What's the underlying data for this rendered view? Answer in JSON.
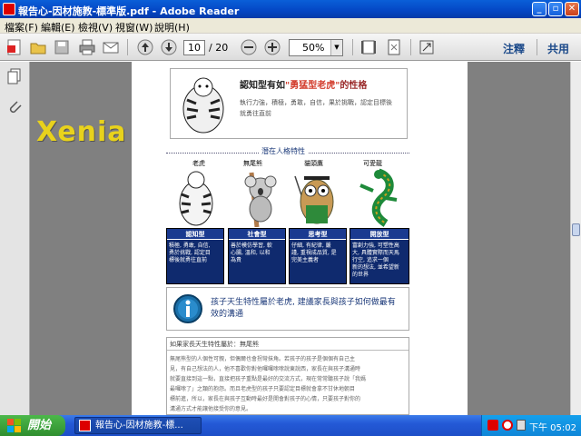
{
  "window": {
    "title": "報告心-因材施教-標準版.pdf - Adobe Reader"
  },
  "menu": [
    "檔案(F)",
    "編輯(E)",
    "檢視(V)",
    "視窗(W)",
    "說明(H)"
  ],
  "toolbar": {
    "page_current": "10",
    "page_total": "/ 20",
    "zoom": "50%",
    "comment": "注釋",
    "share": "共用"
  },
  "watermark": "Xenia",
  "doc": {
    "card_title_a": "認知型有如",
    "card_title_b": "\"勇猛型老虎\"",
    "card_title_c": "的性格",
    "card_desc_1": "執行力強，積極，勇敢，自信，果於挑戰，認定目標後",
    "card_desc_2": "就勇往直前",
    "section_heading": "潛在人格特性",
    "animals": [
      "老虎",
      "無尾熊",
      "貓頭鷹",
      "可愛龍"
    ],
    "types": [
      "認知型",
      "社會型",
      "思考型",
      "開放型"
    ],
    "type_descs": [
      "積極, 勇敢, 自信,\n勇於挑戰, 認定目\n標後就勇往直前",
      "善於模仿學習, 軟\n心腸, 溫和, 以和\n為貴",
      "仔細, 有紀律, 嚴\n謹, 重視成品質, 是\n完美主義者",
      "富創力強, 可塑性高\n大, 具體實際而天馬\n行空, 追求一個\n新的想法, 並希望新\n的世界"
    ],
    "advice_1": "孩子天生特性屬於老虎, 建議家長與孩子如何做最有",
    "advice_2": "效的溝通",
    "box_title": "如果家長天生特性屬於：無尾熊",
    "box_lines": [
      "無尾熊型的人個性可親，但偶爾也會拐彎抹角。若孩子的孩子是個個有自己主",
      "見，有自己想法的人，他不喜歡你對他囉囉嗦嗦說東說西，家長在與孩子溝通時",
      "就要直接到這一點，直接把孩子重點是最好的交流方式，現在常常聽孩子說「我媽",
      "最囉嗦了」之類的抱怨。而且老虎型的孩子只要認定目標就會拿不甘休地朝目",
      "標前進，所以，家長在與孩子互動時最好是開會對孩子的心情，只要孩子對你的",
      "溝通方式才能讓他接受你的意見。"
    ]
  },
  "taskbar": {
    "start": "開始",
    "task": "報告心-因材施教-標...",
    "clock": "下午 05:02"
  },
  "colors": {
    "titlebar": "#0a5fd8",
    "type_box": "#0f2a6e",
    "accent_text": "#d23a2a"
  }
}
